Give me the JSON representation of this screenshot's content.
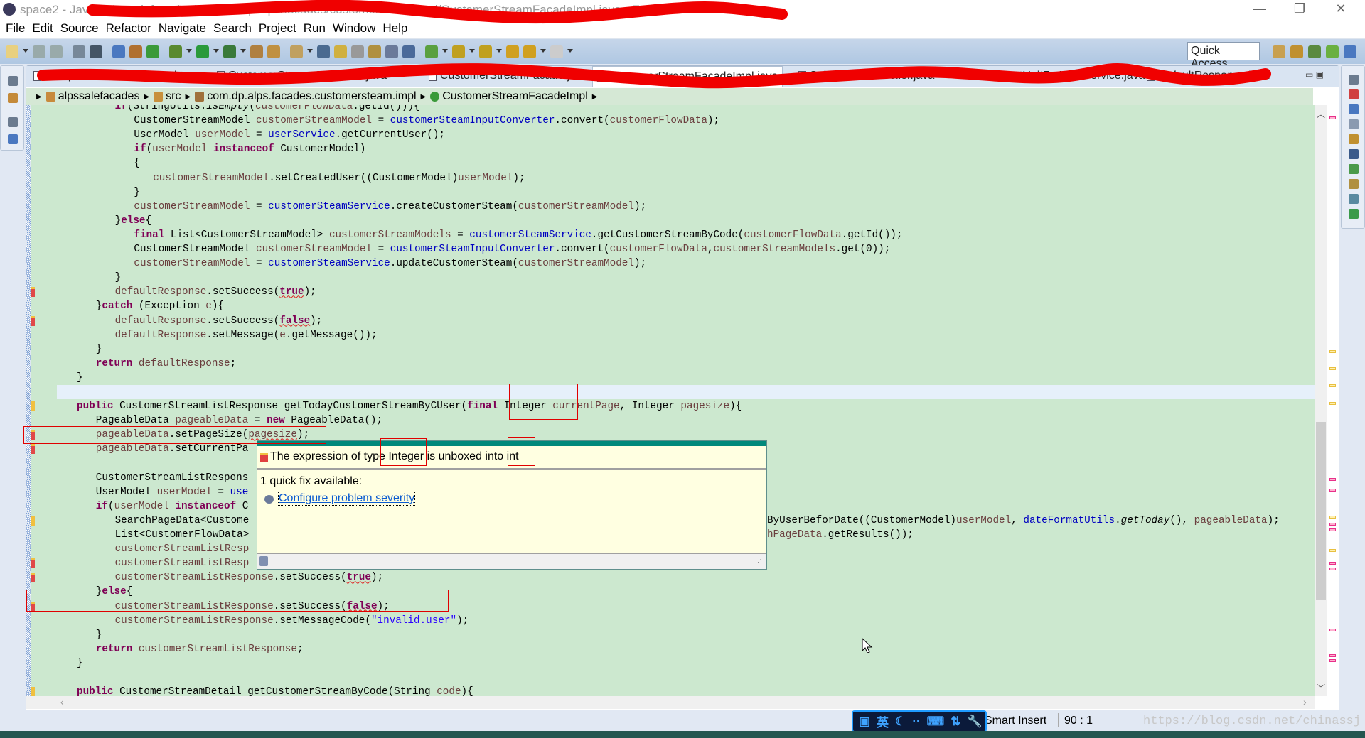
{
  "window": {
    "title": "space2 - Java - alpssalefacades/src/com/dp/alps/facades/customersteam/impl/CustomerStreamFacadeImpl.java - Eclipse",
    "minimize": "—",
    "restore": "❐",
    "close": "✕"
  },
  "menu": [
    "File",
    "Edit",
    "Source",
    "Refactor",
    "Navigate",
    "Search",
    "Project",
    "Run",
    "Window",
    "Help"
  ],
  "toolbar": {
    "icons": [
      "new-icon",
      "save-icon",
      "save-all-icon",
      "binary-icon",
      "terminal-icon",
      "link-icon",
      "package-icon",
      "new-class-icon",
      "debug-icon",
      "run-icon",
      "external-tools-icon",
      "open-type-icon",
      "open-resource-icon",
      "search-icon",
      "toggle-mark-icon",
      "highlight-icon",
      "breakpoint-icon",
      "next-annotation-icon",
      "prev-annotation-icon",
      "paragraph-icon",
      "web-icon",
      "next-edit-icon",
      "prev-edit-icon",
      "last-edit-icon",
      "back-icon",
      "forward-icon"
    ],
    "quick_access": "Quick Access",
    "perspectives": [
      "open-perspective-icon",
      "team-icon",
      "debug-perspective-icon",
      "spring-icon",
      "java-perspective-icon"
    ]
  },
  "tabs": [
    {
      "label": "SampleWebServicesTest.java",
      "active": false
    },
    {
      "label": "CustomerStreamController.java",
      "active": false
    },
    {
      "label": "CustomerStreamFacade.java",
      "active": false
    },
    {
      "label": "CustomerStreamFacadeImpl.java",
      "active": true
    },
    {
      "label": "SalesStanController.java",
      "active": false
    },
    {
      "label": "TestUnitForWebService.java",
      "active": false
    },
    {
      "label": "DefaultResponse.java",
      "active": false
    }
  ],
  "breadcrumb": [
    "alpssalefacades",
    "src",
    "com.dp.alps.facades.customersteam.impl",
    "CustomerStreamFacadeImpl"
  ],
  "colors": {
    "editor_bg": "#cce8cf",
    "keyword": "#7f0055",
    "field": "#0000c0",
    "local_var": "#6a3e3e",
    "string": "#2a00ff",
    "popup_bg": "#ffffe1",
    "popup_bar": "#00897b",
    "annotation_red": "#e00000"
  },
  "code": [
    {
      "n": "70",
      "ind": 3,
      "s": [
        [
          "k",
          "if"
        ],
        [
          "",
          "(StringUtils."
        ],
        [
          "i",
          "isEmpty"
        ],
        [
          "",
          "("
        ],
        [
          "v",
          "customerFlowData"
        ],
        [
          "",
          ".getId())){"
        ]
      ]
    },
    {
      "n": "71",
      "ind": 4,
      "s": [
        [
          "",
          "CustomerStreamModel "
        ],
        [
          "v",
          "customerStreamModel"
        ],
        [
          "",
          " = "
        ],
        [
          "f",
          "customerSteamInputConverter"
        ],
        [
          "",
          ".convert("
        ],
        [
          "v",
          "customerFlowData"
        ],
        [
          "",
          ");"
        ]
      ]
    },
    {
      "n": "72",
      "ind": 4,
      "s": [
        [
          "",
          "UserModel "
        ],
        [
          "v",
          "userModel"
        ],
        [
          "",
          " = "
        ],
        [
          "f",
          "userService"
        ],
        [
          "",
          ".getCurrentUser();"
        ]
      ]
    },
    {
      "n": "73",
      "ind": 4,
      "s": [
        [
          "k",
          "if"
        ],
        [
          "",
          "("
        ],
        [
          "v",
          "userModel"
        ],
        [
          "",
          " "
        ],
        [
          "k",
          "instanceof"
        ],
        [
          "",
          " CustomerModel)"
        ]
      ]
    },
    {
      "n": "74",
      "ind": 4,
      "s": [
        [
          "",
          "{"
        ]
      ]
    },
    {
      "n": "75",
      "ind": 5,
      "s": [
        [
          "v",
          "customerStreamModel"
        ],
        [
          "",
          ".setCreatedUser((CustomerModel)"
        ],
        [
          "v",
          "userModel"
        ],
        [
          "",
          ");"
        ]
      ]
    },
    {
      "n": "76",
      "ind": 4,
      "s": [
        [
          "",
          "}"
        ]
      ]
    },
    {
      "n": "77",
      "ind": 4,
      "s": [
        [
          "v",
          "customerStreamModel"
        ],
        [
          "",
          " = "
        ],
        [
          "f",
          "customerSteamService"
        ],
        [
          "",
          ".createCustomerSteam("
        ],
        [
          "v",
          "customerStreamModel"
        ],
        [
          "",
          ");"
        ]
      ]
    },
    {
      "n": "78",
      "ind": 3,
      "s": [
        [
          "",
          "}"
        ],
        [
          "k",
          "else"
        ],
        [
          "",
          "{"
        ]
      ]
    },
    {
      "n": "79",
      "ind": 4,
      "s": [
        [
          "k",
          "final"
        ],
        [
          "",
          " List<CustomerStreamModel> "
        ],
        [
          "v",
          "customerStreamModels"
        ],
        [
          "",
          " = "
        ],
        [
          "f",
          "customerSteamService"
        ],
        [
          "",
          ".getCustomerStreamByCode("
        ],
        [
          "v",
          "customerFlowData"
        ],
        [
          "",
          ".getId());"
        ]
      ]
    },
    {
      "n": "80",
      "ind": 4,
      "s": [
        [
          "",
          "CustomerStreamModel "
        ],
        [
          "v",
          "customerStreamModel"
        ],
        [
          "",
          " = "
        ],
        [
          "f",
          "customerSteamInputConverter"
        ],
        [
          "",
          ".convert("
        ],
        [
          "v",
          "customerFlowData"
        ],
        [
          "",
          ","
        ],
        [
          "v",
          "customerStreamModels"
        ],
        [
          "",
          ".get(0));"
        ]
      ]
    },
    {
      "n": "81",
      "ind": 4,
      "s": [
        [
          "v",
          "customerStreamModel"
        ],
        [
          "",
          " = "
        ],
        [
          "f",
          "customerSteamService"
        ],
        [
          "",
          ".updateCustomerSteam("
        ],
        [
          "v",
          "customerStreamModel"
        ],
        [
          "",
          ");"
        ]
      ]
    },
    {
      "n": "82",
      "ind": 3,
      "s": [
        [
          "",
          "}"
        ]
      ]
    },
    {
      "n": "83",
      "ind": 3,
      "m": "error",
      "s": [
        [
          "v",
          "defaultResponse"
        ],
        [
          "",
          ".setSuccess("
        ],
        [
          "k u",
          "true"
        ],
        [
          "",
          ");"
        ]
      ]
    },
    {
      "n": "84",
      "ind": 2,
      "s": [
        [
          "",
          "}"
        ],
        [
          "k",
          "catch"
        ],
        [
          "",
          " (Exception "
        ],
        [
          "v",
          "e"
        ],
        [
          "",
          "){"
        ]
      ]
    },
    {
      "n": "85",
      "ind": 3,
      "m": "error",
      "s": [
        [
          "v",
          "defaultResponse"
        ],
        [
          "",
          ".setSuccess("
        ],
        [
          "k u",
          "false"
        ],
        [
          "",
          ");"
        ]
      ]
    },
    {
      "n": "86",
      "ind": 3,
      "s": [
        [
          "v",
          "defaultResponse"
        ],
        [
          "",
          ".setMessage("
        ],
        [
          "v",
          "e"
        ],
        [
          "",
          ".getMessage());"
        ]
      ]
    },
    {
      "n": "87",
      "ind": 2,
      "s": [
        [
          "",
          "}"
        ]
      ]
    },
    {
      "n": "88",
      "ind": 2,
      "s": [
        [
          "k",
          "return"
        ],
        [
          "",
          " "
        ],
        [
          "v",
          "defaultResponse"
        ],
        [
          "",
          ";"
        ]
      ]
    },
    {
      "n": "89",
      "ind": 1,
      "s": [
        [
          "",
          "}"
        ]
      ]
    },
    {
      "n": "90",
      "ind": 0,
      "cur": true,
      "s": []
    },
    {
      "n": "91",
      "ind": 1,
      "m": "warning",
      "s": [
        [
          "k",
          "public"
        ],
        [
          "",
          " CustomerStreamListResponse getTodayCustomerStreamByCUser("
        ],
        [
          "k",
          "final"
        ],
        [
          "",
          " Integer "
        ],
        [
          "v",
          "currentPage"
        ],
        [
          "",
          ", Integer "
        ],
        [
          "v",
          "pagesize"
        ],
        [
          "",
          "){"
        ]
      ]
    },
    {
      "n": "92",
      "ind": 2,
      "s": [
        [
          "",
          "PageableData "
        ],
        [
          "v",
          "pageableData"
        ],
        [
          "",
          " = "
        ],
        [
          "k",
          "new"
        ],
        [
          "",
          " PageableData();"
        ]
      ]
    },
    {
      "n": "93",
      "ind": 2,
      "m": "error",
      "s": [
        [
          "v",
          "pageableData"
        ],
        [
          "",
          ".setPageSize("
        ],
        [
          "v u",
          "pagesize"
        ],
        [
          "",
          ");"
        ]
      ]
    },
    {
      "n": "94",
      "ind": 2,
      "m": "error",
      "s": [
        [
          "v",
          "pageableData"
        ],
        [
          "",
          ".setCurrentPa"
        ]
      ]
    },
    {
      "n": "95",
      "ind": 0,
      "s": []
    },
    {
      "n": "96",
      "ind": 2,
      "s": [
        [
          "",
          "CustomerStreamListRespons"
        ]
      ]
    },
    {
      "n": "97",
      "ind": 2,
      "s": [
        [
          "",
          "UserModel "
        ],
        [
          "v",
          "userModel"
        ],
        [
          "",
          " = "
        ],
        [
          "f",
          "use"
        ]
      ]
    },
    {
      "n": "98",
      "ind": 2,
      "s": [
        [
          "k",
          "if"
        ],
        [
          "",
          "("
        ],
        [
          "v",
          "userModel"
        ],
        [
          "",
          " "
        ],
        [
          "k",
          "instanceof"
        ],
        [
          "",
          " C"
        ]
      ]
    },
    {
      "n": "99",
      "ind": 3,
      "m": "warning",
      "s": [
        [
          "",
          "SearchPageData<Custome"
        ]
      ],
      "tail": [
        [
          "",
          "ByUserBeforDate((CustomerModel)"
        ],
        [
          "v",
          "userModel"
        ],
        [
          "",
          ", "
        ],
        [
          "f",
          "dateFormatUtils"
        ],
        [
          "",
          "."
        ],
        [
          "i",
          "getToday"
        ],
        [
          "",
          "(), "
        ],
        [
          "v",
          "pageableData"
        ],
        [
          "",
          ");"
        ]
      ]
    },
    {
      "n": "100",
      "ind": 3,
      "s": [
        [
          "",
          "List<CustomerFlowData>"
        ]
      ],
      "tail": [
        [
          "v",
          "hPageData"
        ],
        [
          "",
          ".getResults());"
        ]
      ]
    },
    {
      "n": "101",
      "ind": 3,
      "s": [
        [
          "v",
          "customerStreamListResp"
        ]
      ]
    },
    {
      "n": "102",
      "ind": 3,
      "m": "error",
      "s": [
        [
          "v",
          "customerStreamListResp"
        ]
      ]
    },
    {
      "n": "103",
      "ind": 3,
      "m": "error",
      "s": [
        [
          "v",
          "customerStreamListResponse"
        ],
        [
          "",
          ".setSuccess("
        ],
        [
          "k u",
          "true"
        ],
        [
          "",
          ");"
        ]
      ]
    },
    {
      "n": "104",
      "ind": 2,
      "s": [
        [
          "",
          "}"
        ],
        [
          "k",
          "else"
        ],
        [
          "",
          "{"
        ]
      ]
    },
    {
      "n": "105",
      "ind": 3,
      "m": "error",
      "s": [
        [
          "v",
          "customerStreamListResponse"
        ],
        [
          "",
          ".setSuccess("
        ],
        [
          "k u",
          "false"
        ],
        [
          "",
          ");"
        ]
      ]
    },
    {
      "n": "106",
      "ind": 3,
      "s": [
        [
          "v",
          "customerStreamListResponse"
        ],
        [
          "",
          ".setMessageCode("
        ],
        [
          "s",
          "\"invalid.user\""
        ],
        [
          "",
          ");"
        ]
      ]
    },
    {
      "n": "107",
      "ind": 2,
      "s": [
        [
          "",
          "}"
        ]
      ]
    },
    {
      "n": "108",
      "ind": 2,
      "s": [
        [
          "k",
          "return"
        ],
        [
          "",
          " "
        ],
        [
          "v",
          "customerStreamListResponse"
        ],
        [
          "",
          ";"
        ]
      ]
    },
    {
      "n": "109",
      "ind": 1,
      "s": [
        [
          "",
          "}"
        ]
      ]
    },
    {
      "n": "110",
      "ind": 0,
      "s": []
    },
    {
      "n": "111",
      "ind": 1,
      "m": "warning",
      "s": [
        [
          "k",
          "public"
        ],
        [
          "",
          " CustomerStreamDetail getCustomerStreamByCode(String "
        ],
        [
          "v",
          "code"
        ],
        [
          "",
          "){"
        ]
      ]
    }
  ],
  "popup": {
    "message": "The expression of type Integer is unboxed into int",
    "fix_count": "1 quick fix available:",
    "fix": "Configure problem severity"
  },
  "status": {
    "insert_mode": "Smart Insert",
    "position": "90 : 1",
    "ime_lang": "英"
  },
  "watermark": "https://blog.csdn.net/chinassj"
}
